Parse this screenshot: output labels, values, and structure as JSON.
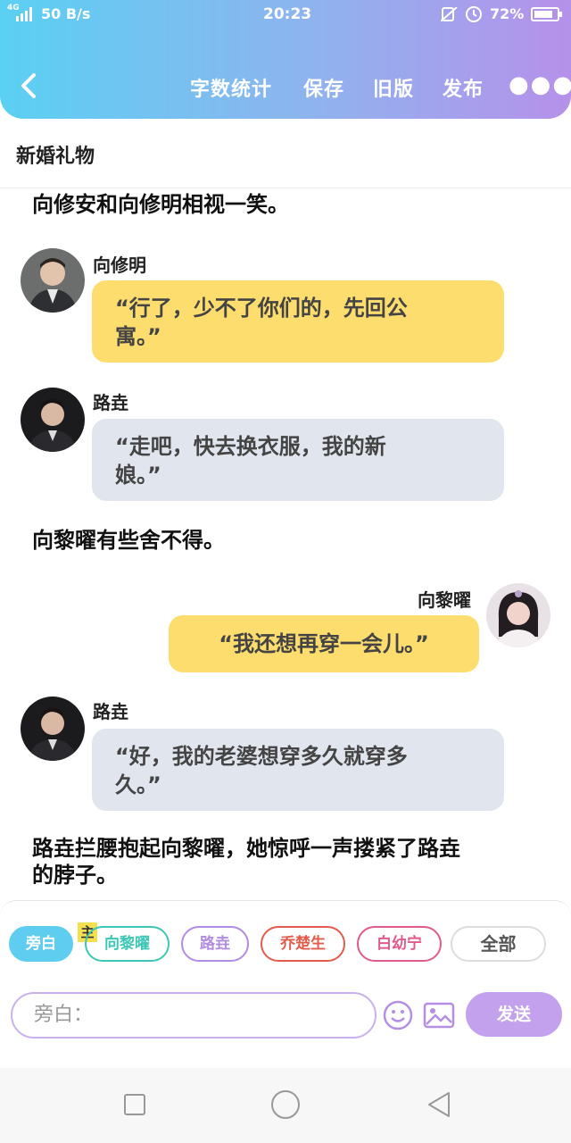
{
  "status_bar": {
    "network": "4G",
    "speed": "50 B/s",
    "time": "20:23",
    "battery": "72%"
  },
  "toolbar": {
    "word_count": "字数统计",
    "save": "保存",
    "old_version": "旧版",
    "publish": "发布"
  },
  "doc_title": "新婚礼物",
  "messages": {
    "n1": "向修安和向修明相视一笑。",
    "m1": {
      "name": "向修明",
      "text_line1": "“行了，少不了你们的，先回公",
      "text_line2": "寓。”"
    },
    "m2": {
      "name": "路垚",
      "text_line1": "“走吧，快去换衣服，我的新",
      "text_line2": "娘。”"
    },
    "n2": "向黎曜有些舍不得。",
    "m3": {
      "name": "向黎曜",
      "text": "“我还想再穿一会儿。”"
    },
    "m4": {
      "name": "路垚",
      "text_line1": "“好，我的老婆想穿多久就穿多",
      "text_line2": "久。”"
    },
    "n3_line1": "路垚拦腰抱起向黎曜，她惊呼一声搂紧了路垚",
    "n3_line2": "的脖子。"
  },
  "characters": {
    "main_badge": "主",
    "chips": [
      "旁白",
      "向黎曜",
      "路垚",
      "乔楚生",
      "白幼宁",
      "全部"
    ]
  },
  "composer": {
    "placeholder": "旁白：",
    "send": "发送"
  },
  "colors": {
    "header_start": "#5ad0f3",
    "header_end": "#b691ea",
    "bubble_yellow": "#fedd6f",
    "bubble_gray": "#e1e6ee",
    "send_button": "#c4a1ec"
  }
}
